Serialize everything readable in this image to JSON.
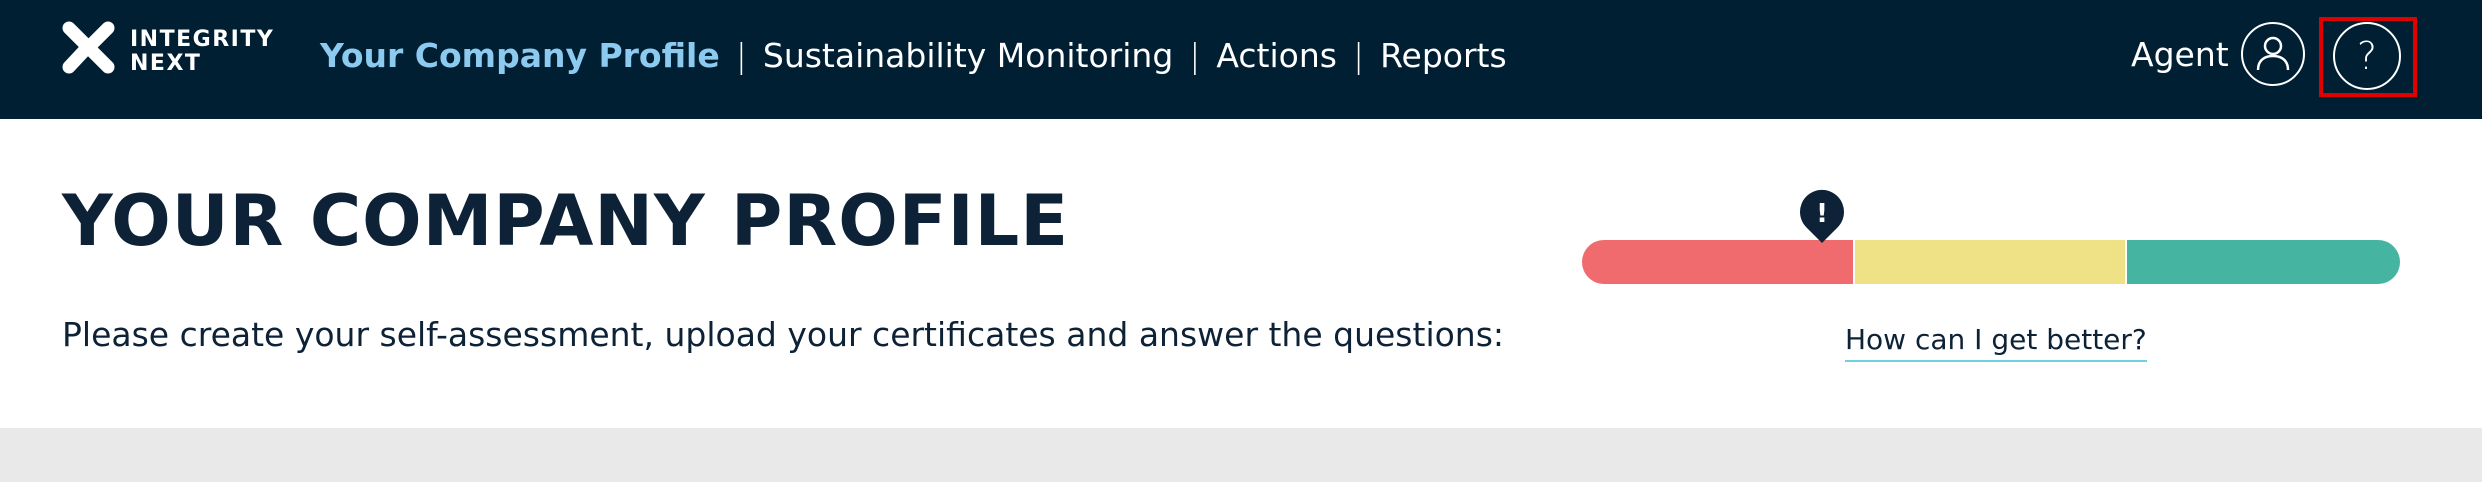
{
  "header": {
    "logo": {
      "line1": "INTEGRITY",
      "line2": "NEXT"
    },
    "nav": [
      {
        "label": "Your Company Profile",
        "active": true
      },
      {
        "label": "Sustainability Monitoring",
        "active": false
      },
      {
        "label": "Actions",
        "active": false
      },
      {
        "label": "Reports",
        "active": false
      }
    ],
    "separator": "|",
    "user_label": "Agent",
    "user_icon": "user-icon",
    "help_icon": "help-icon",
    "help_glyph": "?"
  },
  "main": {
    "title": "YOUR COMPANY PROFILE",
    "subtitle": "Please create your self-assessment, upload your certificates and answer the questions:",
    "score": {
      "marker_glyph": "!",
      "level": 0.33,
      "segment_colors": [
        "#ef6b6e",
        "#efe186",
        "#45b4a1"
      ],
      "link_label": "How can I get better?"
    }
  },
  "colors": {
    "header_bg": "#001f33",
    "active_nav": "#8ccaf0",
    "title_text": "#0d2236",
    "highlight": "#e00000",
    "link_underline": "#6fd1e0"
  }
}
